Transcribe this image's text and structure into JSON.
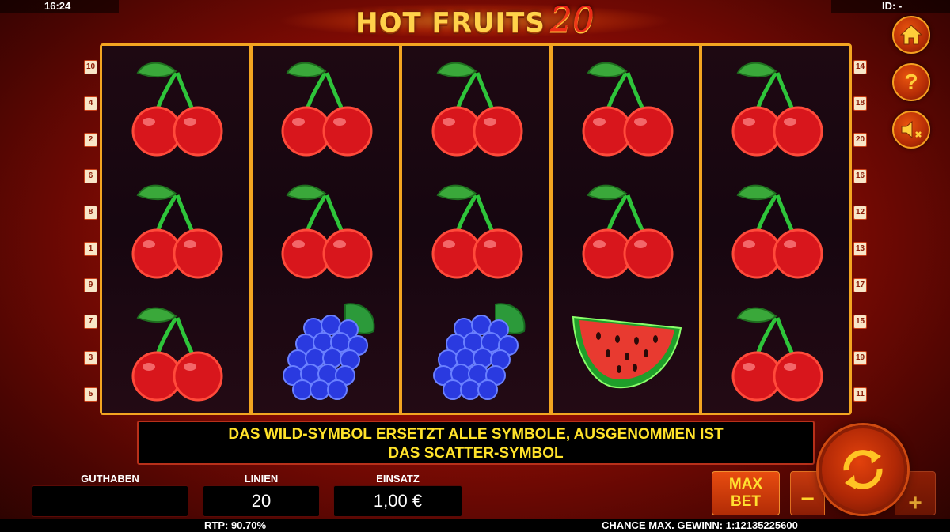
{
  "status": {
    "time": "16:24",
    "id_label": "ID: -"
  },
  "logo": {
    "text": "HOT FRUITS",
    "number": "20"
  },
  "reels": [
    [
      "cherry",
      "cherry",
      "cherry"
    ],
    [
      "cherry",
      "cherry",
      "grapes"
    ],
    [
      "cherry",
      "cherry",
      "grapes"
    ],
    [
      "cherry",
      "cherry",
      "watermelon"
    ],
    [
      "cherry",
      "cherry",
      "cherry"
    ]
  ],
  "paylines": {
    "left": [
      "10",
      "4",
      "2",
      "6",
      "8",
      "1",
      "9",
      "7",
      "3",
      "5"
    ],
    "right": [
      "14",
      "18",
      "20",
      "16",
      "12",
      "13",
      "17",
      "15",
      "19",
      "11"
    ]
  },
  "side_buttons": {
    "home_icon": "home-icon",
    "help_label": "?",
    "sound_icon": "sound-muted-icon"
  },
  "info_message": {
    "line1": "DAS WILD-SYMBOL ERSETZT ALLE SYMBOLE, AUSGENOMMEN IST",
    "line2": "DAS SCATTER-SYMBOL"
  },
  "fields": {
    "balance": {
      "label": "GUTHABEN",
      "value": ""
    },
    "lines": {
      "label": "LINIEN",
      "value": "20"
    },
    "bet": {
      "label": "EINSATZ",
      "value": "1,00 €"
    }
  },
  "controls": {
    "maxbet_line1": "MAX",
    "maxbet_line2": "BET",
    "minus": "−",
    "plus": "+",
    "spin_icon": "spin-arrows-icon"
  },
  "footer": {
    "rtp": "RTP: 90.70%",
    "max_win_chance": "CHANCE MAX. GEWINN: 1:12135225600"
  },
  "colors": {
    "frame": "#f3a521",
    "message_text": "#ffe22a",
    "background": "#8a0c04"
  }
}
